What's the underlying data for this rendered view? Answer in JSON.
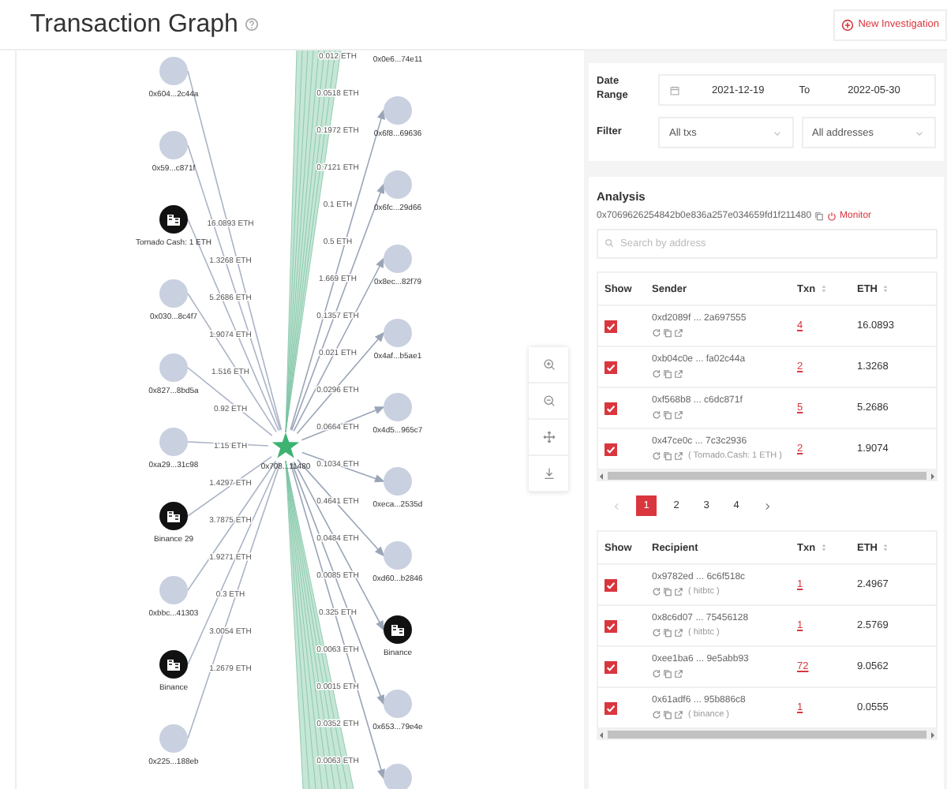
{
  "header": {
    "title": "Transaction Graph",
    "new_button": "New Investigation"
  },
  "graph": {
    "center_label": "0x708...11480",
    "senders": [
      {
        "kind": "address",
        "label": "0x604...2c44a"
      },
      {
        "kind": "address",
        "label": "0x59...c871f"
      },
      {
        "kind": "entity",
        "label": "Tornado Cash: 1 ETH"
      },
      {
        "kind": "address",
        "label": "0x030...8c4f7"
      },
      {
        "kind": "address",
        "label": "0x827...8bd5a"
      },
      {
        "kind": "address",
        "label": "0xa29...31c98"
      },
      {
        "kind": "entity",
        "label": "Binance 29"
      },
      {
        "kind": "address",
        "label": "0xbbc...41303"
      },
      {
        "kind": "entity",
        "label": "Binance"
      },
      {
        "kind": "address",
        "label": "0x225...188eb"
      }
    ],
    "sender_amounts": [
      "16.0893 ETH",
      "1.3268 ETH",
      "5.2686 ETH",
      "1.9074 ETH",
      "1.516 ETH",
      "0.92 ETH",
      "1.15 ETH",
      "1.4297 ETH",
      "3.7875 ETH",
      "1.9271 ETH",
      "0.3 ETH",
      "3.0054 ETH",
      "1.2679 ETH"
    ],
    "recipients": [
      {
        "kind": "cut",
        "label": "0x0e6...74e11"
      },
      {
        "kind": "address",
        "label": "0x6f8...69636"
      },
      {
        "kind": "address",
        "label": "0x6fc...29d66"
      },
      {
        "kind": "address",
        "label": "0x8ec...82f79"
      },
      {
        "kind": "address",
        "label": "0x4af...b5ae1"
      },
      {
        "kind": "address",
        "label": "0x4d5...965c7"
      },
      {
        "kind": "address",
        "label": "0xeca...2535d"
      },
      {
        "kind": "address",
        "label": "0xd60...b2846"
      },
      {
        "kind": "entity",
        "label": "Binance"
      },
      {
        "kind": "address",
        "label": "0x653...79e4e"
      },
      {
        "kind": "address"
      }
    ],
    "recipient_amounts": [
      "0.012 ETH",
      "0.0518 ETH",
      "0.1972 ETH",
      "0.7121 ETH",
      "0.1 ETH",
      "0.5 ETH",
      "1.669 ETH",
      "0.1357 ETH",
      "0.021 ETH",
      "0.0296 ETH",
      "0.0664 ETH",
      "0.1034 ETH",
      "0.4641 ETH",
      "0.0484 ETH",
      "0.0085 ETH",
      "0.325 ETH",
      "0.0063 ETH",
      "0.0015 ETH",
      "0.0352 ETH",
      "0.0063 ETH"
    ]
  },
  "filters": {
    "date_label": "Date Range",
    "date_from": "2021-12-19",
    "to_label": "To",
    "date_to": "2022-05-30",
    "filter_label": "Filter",
    "tx_filter": "All txs",
    "address_filter": "All addresses"
  },
  "analysis": {
    "title": "Analysis",
    "address": "0x7069626254842b0e836a257e034659fd1f211480",
    "monitor": "Monitor",
    "search": {
      "placeholder": "Search by address"
    },
    "senders": {
      "columns": [
        {
          "label": "Show",
          "sortable": false
        },
        {
          "label": "Sender",
          "sortable": false
        },
        {
          "label": "Txn",
          "sortable": true
        },
        {
          "label": "ETH",
          "sortable": true
        }
      ],
      "rows": [
        {
          "checked": true,
          "address": "0xd2089f ... 2a697555",
          "txn": "4",
          "eth": "16.0893"
        },
        {
          "checked": true,
          "address": "0xb04c0e ... fa02c44a",
          "txn": "2",
          "eth": "1.3268"
        },
        {
          "checked": true,
          "address": "0xf568b8 ... c6dc871f",
          "txn": "5",
          "eth": "5.2686"
        },
        {
          "checked": true,
          "address": "0x47ce0c ... 7c3c2936",
          "tag": "( Tornado.Cash: 1 ETH )",
          "txn": "2",
          "eth": "1.9074"
        }
      ]
    },
    "pages": [
      {
        "label": "1",
        "selected": true
      },
      {
        "label": "2",
        "selected": false
      },
      {
        "label": "3",
        "selected": false
      },
      {
        "label": "4",
        "selected": false
      }
    ],
    "recipients": {
      "columns": [
        {
          "label": "Show",
          "sortable": false
        },
        {
          "label": "Recipient",
          "sortable": false
        },
        {
          "label": "Txn",
          "sortable": true
        },
        {
          "label": "ETH",
          "sortable": true
        }
      ],
      "rows": [
        {
          "checked": true,
          "address": "0x9782ed ... 6c6f518c",
          "tag": "( hitbtc )",
          "txn": "1",
          "eth": "2.4967"
        },
        {
          "checked": true,
          "address": "0x8c6d07 ... 75456128",
          "tag": "( hitbtc )",
          "txn": "1",
          "eth": "2.5769"
        },
        {
          "checked": true,
          "address": "0xee1ba6 ... 9e5abb93",
          "txn": "72",
          "eth": "9.0562"
        },
        {
          "checked": true,
          "address": "0x61adf6 ... 95b886c8",
          "tag": "( binance )",
          "txn": "1",
          "eth": "0.0555"
        }
      ]
    }
  }
}
